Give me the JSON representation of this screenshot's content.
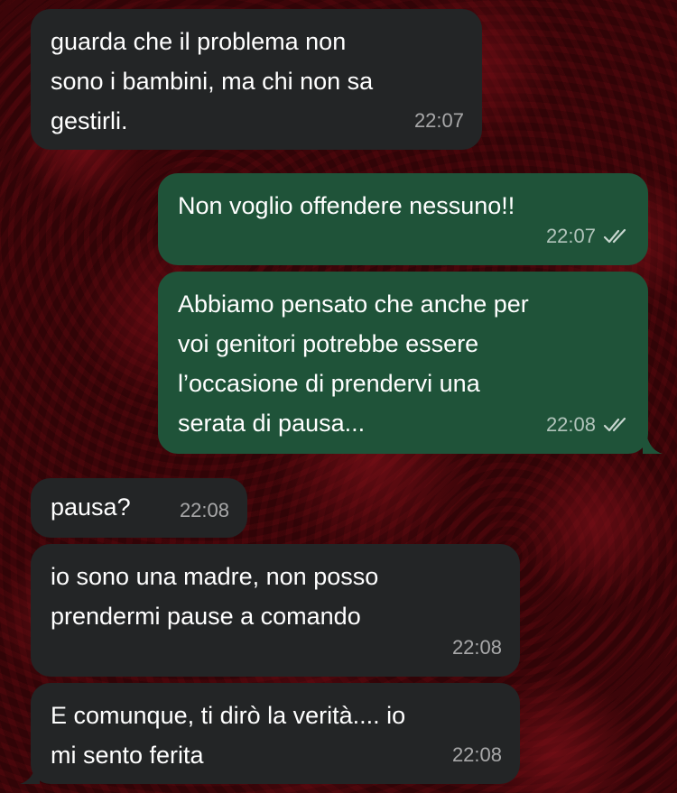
{
  "messages": [
    {
      "direction": "in",
      "text": "guarda che il problema  non\nsono i bambini, ma chi non sa\ngestirli.",
      "time": "22:07"
    },
    {
      "direction": "out",
      "text": "Non voglio offendere nessuno!!",
      "time": "22:07",
      "status": "read"
    },
    {
      "direction": "out",
      "text": "Abbiamo pensato che anche per\nvoi genitori potrebbe essere\nl’occasione di prendervi una\nserata di pausa...",
      "time": "22:08",
      "status": "read"
    },
    {
      "direction": "in",
      "text": "pausa?",
      "time": "22:08"
    },
    {
      "direction": "in",
      "text": "io sono una madre, non posso\nprendermi pause a comando",
      "time": "22:08"
    },
    {
      "direction": "in",
      "text": "E comunque, ti dirò la verità.... io\nmi sento ferita",
      "time": "22:08"
    }
  ],
  "colors": {
    "incoming_bubble": "#232526",
    "outgoing_bubble": "#1f5339",
    "read_ticks": "#c8d6cf"
  },
  "icons": {
    "read_status": "double-check-icon"
  }
}
